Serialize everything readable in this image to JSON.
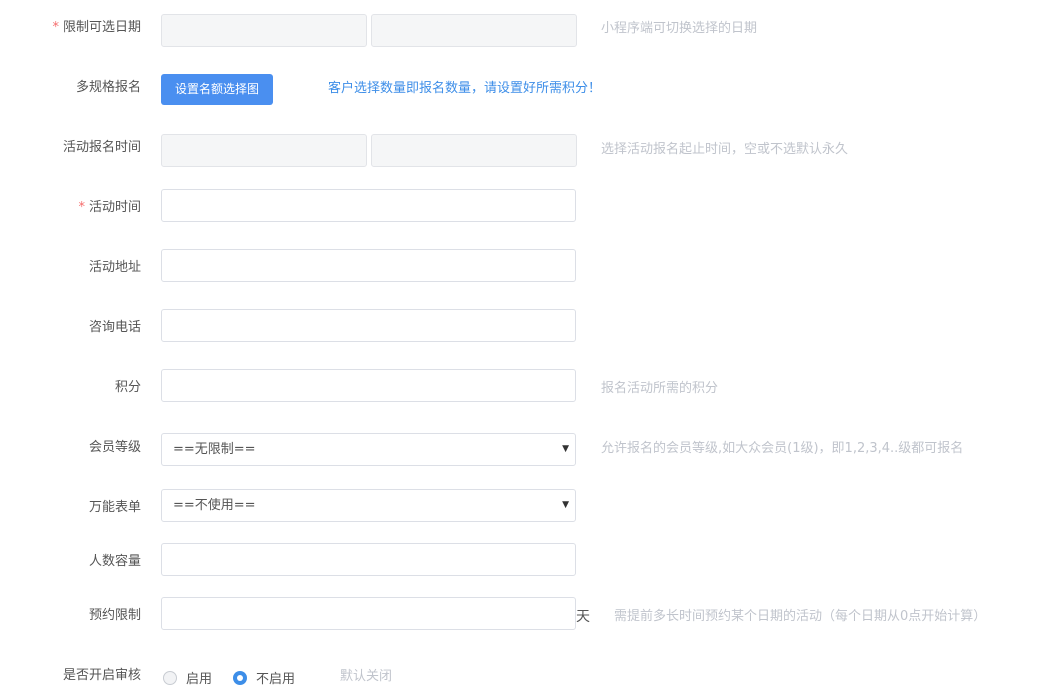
{
  "form": {
    "date_limit": {
      "label": "限制可选日期",
      "start_value": "",
      "end_value": "",
      "hint": "小程序端可切换选择的日期"
    },
    "multi_spec": {
      "label": "多规格报名",
      "button_label": "设置名额选择图",
      "hint": "客户选择数量即报名数量，请设置好所需积分！"
    },
    "signup_time": {
      "label": "活动报名时间",
      "start_value": "",
      "end_value": "",
      "hint": "选择活动报名起止时间，空或不选默认永久"
    },
    "activity_time": {
      "label": "活动时间",
      "value": ""
    },
    "address": {
      "label": "活动地址",
      "value": ""
    },
    "phone": {
      "label": "咨询电话",
      "value": ""
    },
    "points": {
      "label": "积分",
      "value": "",
      "hint": "报名活动所需的积分"
    },
    "member_level": {
      "label": "会员等级",
      "selected": "==无限制==",
      "hint": "允许报名的会员等级,如大众会员(1级)，即1,2,3,4..级都可报名"
    },
    "form_select": {
      "label": "万能表单",
      "selected": "==不使用=="
    },
    "capacity": {
      "label": "人数容量",
      "value": ""
    },
    "reservation": {
      "label": "预约限制",
      "value": "",
      "unit": "天",
      "hint": "需提前多长时间预约某个日期的活动（每个日期从0点开始计算）"
    },
    "review": {
      "label": "是否开启审核",
      "option_on": "启用",
      "option_off": "不启用",
      "selected": "不启用",
      "hint": "默认关闭"
    }
  },
  "required_mark": "*",
  "colors": {
    "accent": "#4a8ff0",
    "required": "#f56c6c",
    "hint": "#c0c4cc",
    "hint_blue": "#3d8ee8"
  },
  "icons": {
    "select_arrow": "caret-down-icon"
  }
}
